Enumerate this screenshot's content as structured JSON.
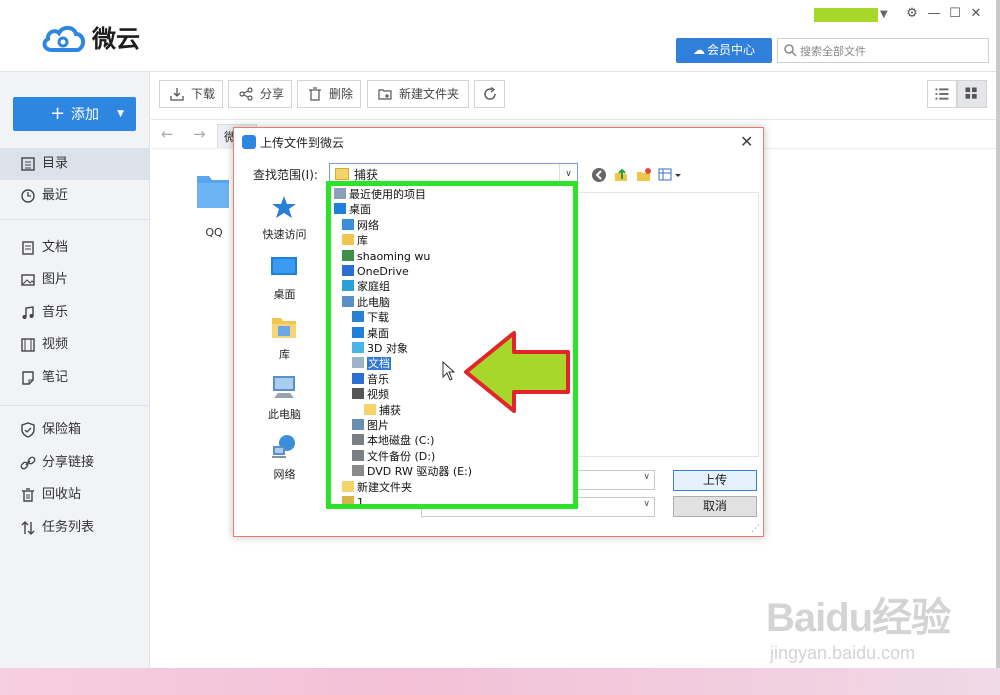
{
  "app": {
    "name": "微云",
    "vip_label": "会员中心",
    "search_placeholder": "搜索全部文件",
    "window_controls": [
      "gear-icon",
      "minimize-icon",
      "maximize-icon",
      "close-icon"
    ]
  },
  "sidebar": {
    "add_label": "添加",
    "items": [
      {
        "label": "目录",
        "icon": "catalog-icon",
        "active": true
      },
      {
        "label": "最近",
        "icon": "clock-icon"
      },
      {
        "label": "文档",
        "icon": "document-icon"
      },
      {
        "label": "图片",
        "icon": "image-icon"
      },
      {
        "label": "音乐",
        "icon": "music-icon"
      },
      {
        "label": "视频",
        "icon": "video-icon"
      },
      {
        "label": "笔记",
        "icon": "note-icon"
      },
      {
        "label": "保险箱",
        "icon": "safe-icon"
      },
      {
        "label": "分享链接",
        "icon": "share-link-icon"
      },
      {
        "label": "回收站",
        "icon": "trash-icon"
      },
      {
        "label": "任务列表",
        "icon": "task-list-icon"
      }
    ]
  },
  "toolbar": {
    "download": "下载",
    "share": "分享",
    "delete": "删除",
    "new_folder": "新建文件夹"
  },
  "breadcrumb": {
    "tab": "微"
  },
  "content": {
    "folder_name": "QQ"
  },
  "dialog": {
    "title": "上传文件到微云",
    "lookin_label": "查找范围(I):",
    "lookin_value": "捕获",
    "places": [
      "快速访问",
      "桌面",
      "库",
      "此电脑",
      "网络"
    ],
    "upload_button": "上传",
    "cancel_button": "取消",
    "dropdown_items": [
      {
        "label": "最近使用的项目",
        "icon": "recent-icon",
        "indent": 0
      },
      {
        "label": "桌面",
        "icon": "desktop-icon",
        "indent": 0
      },
      {
        "label": "网络",
        "icon": "network-icon",
        "indent": 1
      },
      {
        "label": "库",
        "icon": "library-icon",
        "indent": 1
      },
      {
        "label": "shaoming wu",
        "icon": "user-icon",
        "indent": 1
      },
      {
        "label": "OneDrive",
        "icon": "onedrive-icon",
        "indent": 1
      },
      {
        "label": "家庭组",
        "icon": "homegroup-icon",
        "indent": 1
      },
      {
        "label": "此电脑",
        "icon": "computer-icon",
        "indent": 1
      },
      {
        "label": "下载",
        "icon": "download-icon",
        "indent": 2
      },
      {
        "label": "桌面",
        "icon": "desktop-icon",
        "indent": 2
      },
      {
        "label": "3D 对象",
        "icon": "3d-object-icon",
        "indent": 2
      },
      {
        "label": "文档",
        "icon": "document-icon",
        "indent": 2,
        "selected": true
      },
      {
        "label": "音乐",
        "icon": "music-icon",
        "indent": 2
      },
      {
        "label": "视频",
        "icon": "video-icon",
        "indent": 2
      },
      {
        "label": "捕获",
        "icon": "folder-icon",
        "indent": 3
      },
      {
        "label": "图片",
        "icon": "image-icon",
        "indent": 2
      },
      {
        "label": "本地磁盘 (C:)",
        "icon": "drive-icon",
        "indent": 2
      },
      {
        "label": "文件备份 (D:)",
        "icon": "drive-icon",
        "indent": 2
      },
      {
        "label": "DVD RW 驱动器 (E:)",
        "icon": "dvd-icon",
        "indent": 2
      },
      {
        "label": "新建文件夹",
        "icon": "folder-icon",
        "indent": 1
      },
      {
        "label": "1",
        "icon": "zip-icon",
        "indent": 1
      }
    ]
  },
  "watermark": {
    "logo": "Baidu经验",
    "url": "jingyan.baidu.com"
  },
  "colors": {
    "accent": "#2d86e0",
    "highlight_border": "#2de32a",
    "arrow_fill": "#a6d72a",
    "arrow_border": "#e3242b",
    "user_bar": "#a6d72a"
  }
}
